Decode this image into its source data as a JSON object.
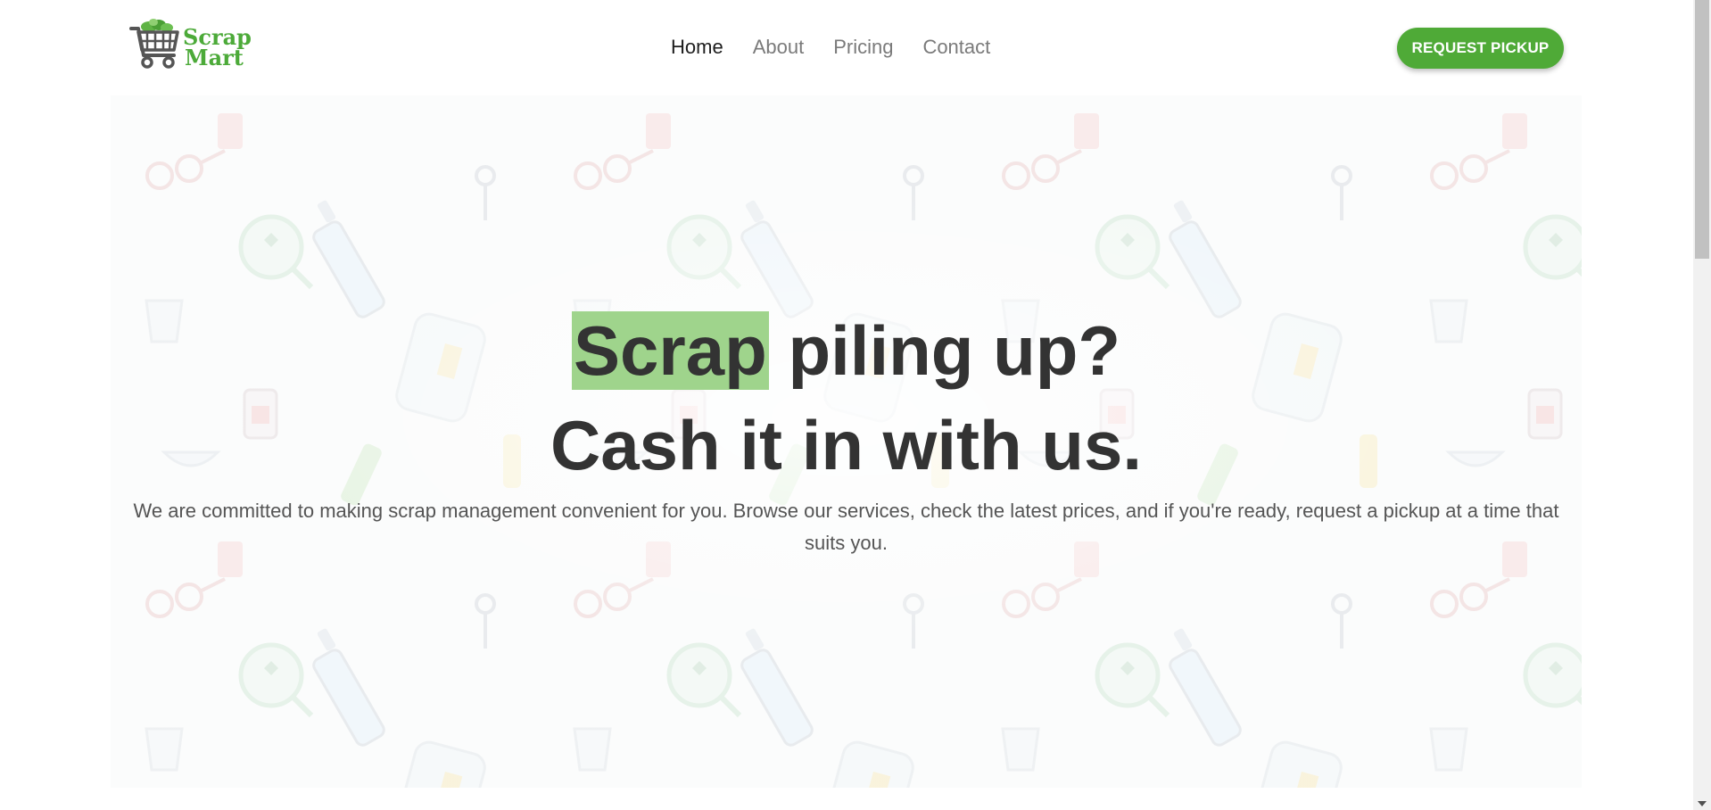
{
  "brand": {
    "logo_line1": "Scrap",
    "logo_line2": "Mart",
    "color_primary": "#4faa37"
  },
  "nav": {
    "items": [
      {
        "label": "Home",
        "active": true
      },
      {
        "label": "About",
        "active": false
      },
      {
        "label": "Pricing",
        "active": false
      },
      {
        "label": "Contact",
        "active": false
      }
    ],
    "cta_label": "REQUEST PICKUP"
  },
  "hero": {
    "headline_highlight": "Scrap",
    "headline_rest": " piling up?",
    "headline_line2": "Cash it in with us.",
    "subtext": "We are committed to making scrap management convenient for you. Browse our services, check the latest prices, and if you're ready, request a pickup at a time that suits you.",
    "highlight_color": "#9fd48c",
    "background_pattern": "recyclables-doodle-pattern"
  }
}
